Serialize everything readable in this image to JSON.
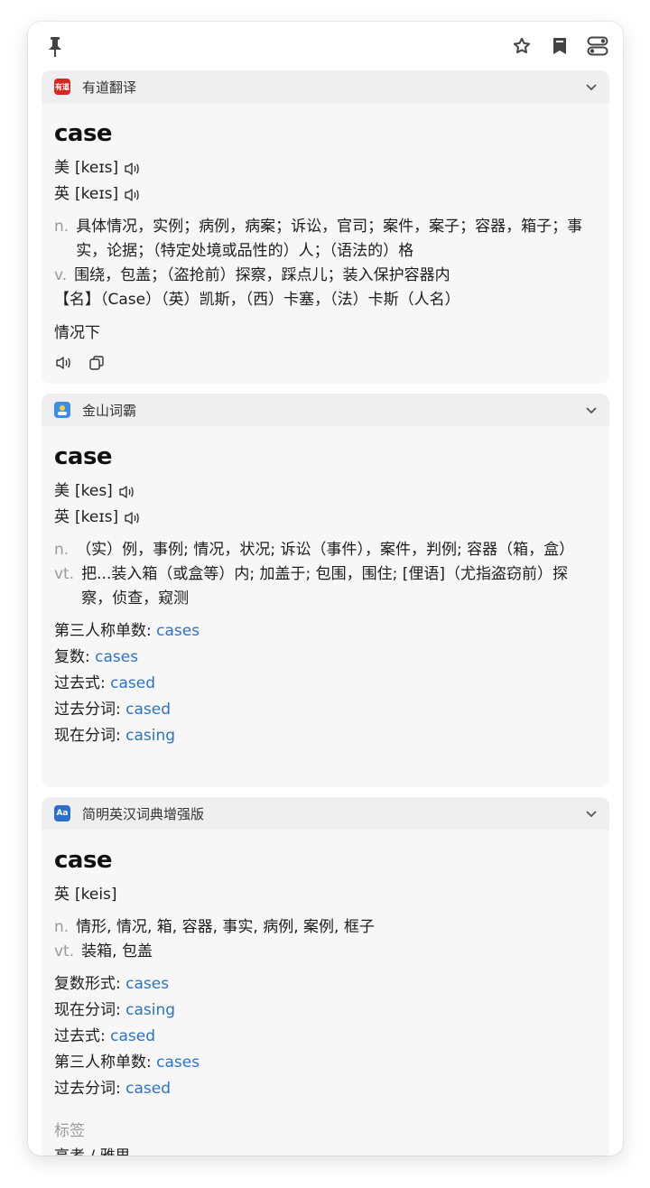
{
  "cards": [
    {
      "source": "有道翻译",
      "icon_text": "有道",
      "icon": "youdao-logo-icon",
      "accent": "#d6281f",
      "word": "case",
      "phonetics": [
        {
          "label": "美",
          "ipa": "[keɪs]"
        },
        {
          "label": "英",
          "ipa": "[keɪs]"
        }
      ],
      "definitions": [
        {
          "pos": "n.",
          "text": "具体情况，实例；病例，病案；诉讼，官司；案件，案子；容器，箱子；事实，论据；（特定处境或品性的）人；（语法的）格"
        },
        {
          "pos": "v.",
          "text": "围绕，包盖；（盗抢前）探察，踩点儿；装入保护容器内"
        }
      ],
      "extra_line": "【名】（Case）（英）凯斯，（西）卡塞，（法）卡斯（人名）",
      "translation": "情况下"
    },
    {
      "source": "金山词霸",
      "icon": "jinshan-logo-icon",
      "word": "case",
      "phonetics": [
        {
          "label": "美",
          "ipa": "[kes]"
        },
        {
          "label": "英",
          "ipa": "[keɪs]"
        }
      ],
      "definitions": [
        {
          "pos": "n.",
          "text": "（实）例，事例; 情况，状况; 诉讼（事件），案件，判例; 容器（箱，盒）"
        },
        {
          "pos": "vt.",
          "text": "把...装入箱（或盒等）内; 加盖于; 包围，围住; [俚语]（尤指盗窃前）探察，侦查，窥测"
        }
      ],
      "forms": [
        {
          "label": "第三人称单数:",
          "value": "cases"
        },
        {
          "label": "复数:",
          "value": "cases"
        },
        {
          "label": "过去式:",
          "value": "cased"
        },
        {
          "label": "过去分词:",
          "value": "cased"
        },
        {
          "label": "现在分词:",
          "value": "casing"
        }
      ]
    },
    {
      "source": "简明英汉词典增强版",
      "icon_text": "Aa",
      "icon": "dictionary-logo-icon",
      "accent": "#2a6fc9",
      "word": "case",
      "phonetics": [
        {
          "label": "英",
          "ipa": "[keis]"
        }
      ],
      "definitions": [
        {
          "pos": "n.",
          "text": "情形, 情况, 箱, 容器, 事实, 病例, 案例, 框子"
        },
        {
          "pos": "vt.",
          "text": "装箱, 包盖"
        }
      ],
      "forms": [
        {
          "label": "复数形式:",
          "value": "cases"
        },
        {
          "label": "现在分词:",
          "value": "casing"
        },
        {
          "label": "过去式:",
          "value": "cased"
        },
        {
          "label": "第三人称单数:",
          "value": "cases"
        },
        {
          "label": "过去分词:",
          "value": "cased"
        }
      ],
      "tags_label": "标签",
      "tags_value": "高考 / 雅思"
    }
  ],
  "link_color": "#2b73c9"
}
